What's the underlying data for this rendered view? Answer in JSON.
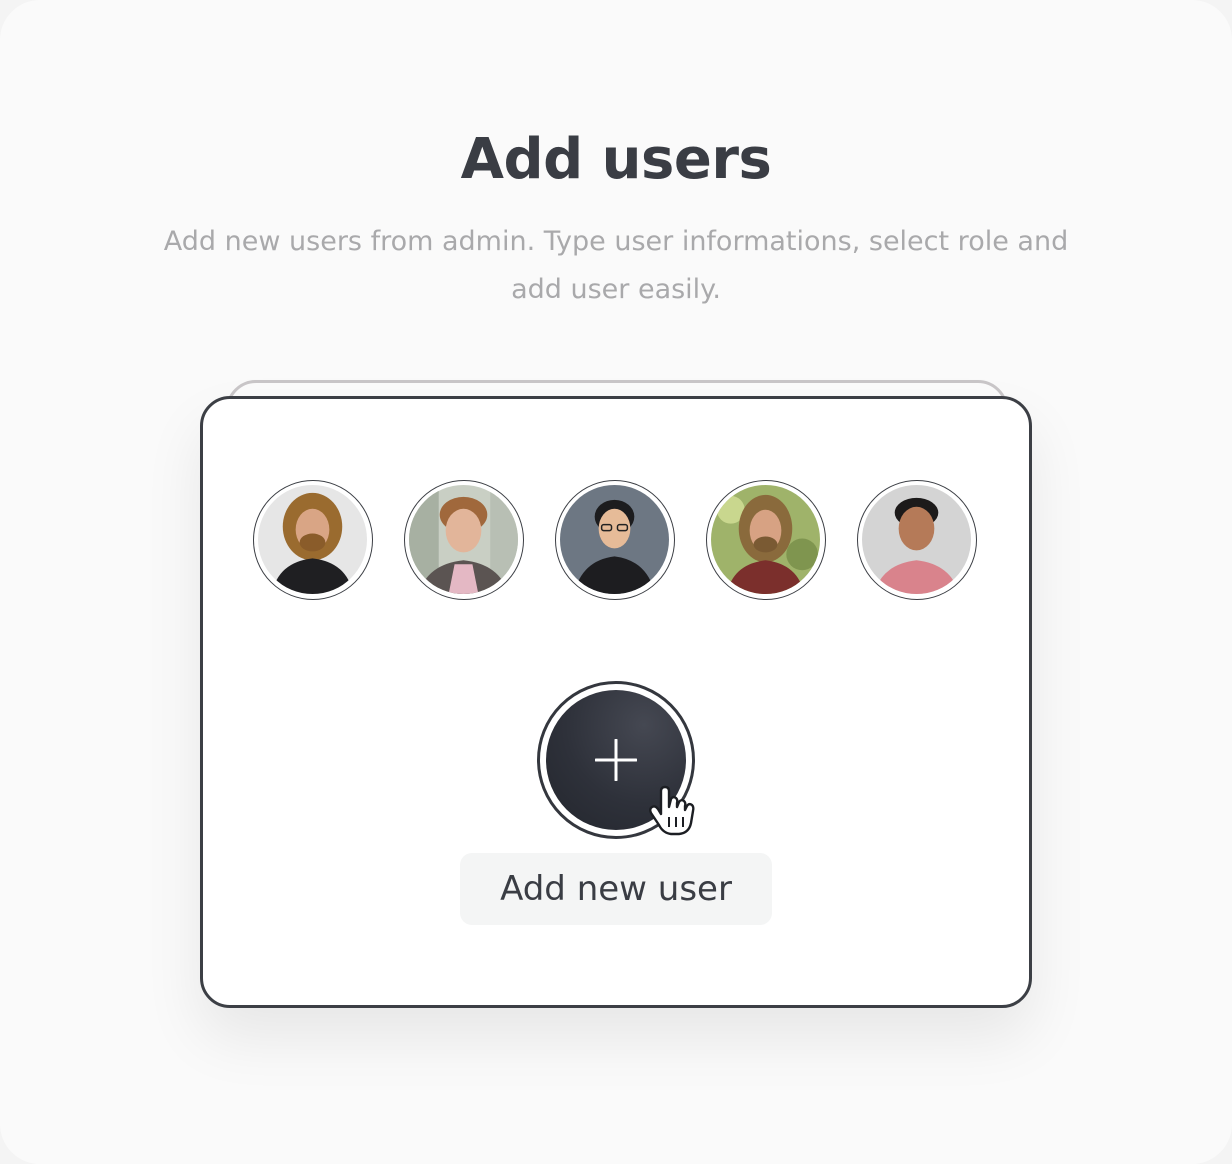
{
  "header": {
    "title": "Add users",
    "subtitle": "Add new users from admin. Type user informations, select role and add user easily."
  },
  "users": {
    "avatars": [
      {
        "icon": "user-avatar-1"
      },
      {
        "icon": "user-avatar-2"
      },
      {
        "icon": "user-avatar-3"
      },
      {
        "icon": "user-avatar-4"
      },
      {
        "icon": "user-avatar-5"
      }
    ]
  },
  "actions": {
    "add_button_icon": "plus-icon",
    "add_label": "Add new user",
    "cursor_icon": "hand-pointer-icon"
  },
  "colors": {
    "title": "#3a3d44",
    "subtitle": "#a9a9ab",
    "border": "#3c3f45",
    "button": "#2e313a",
    "label_bg": "#f4f5f5"
  }
}
